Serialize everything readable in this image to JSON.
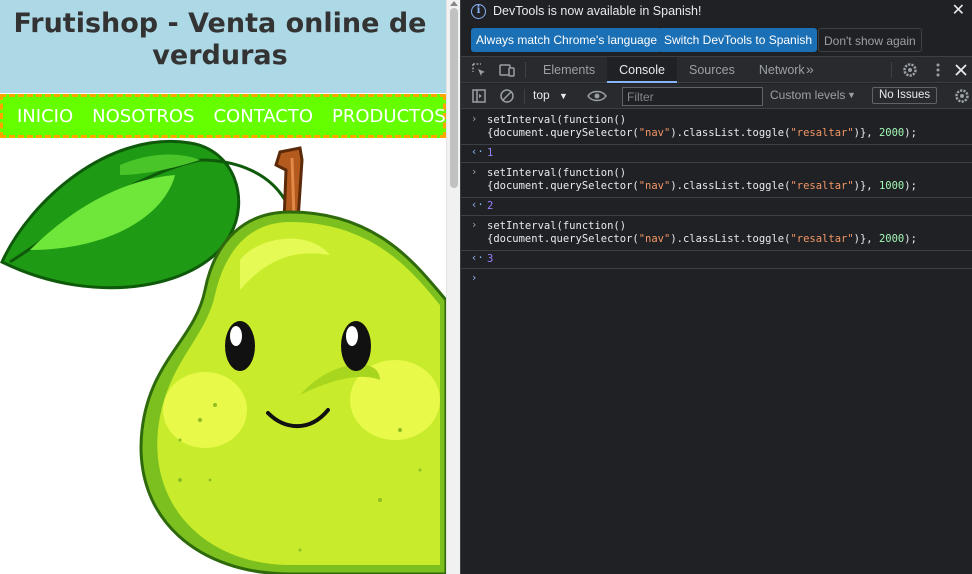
{
  "page": {
    "title": "Frutishop - Venta online de verduras",
    "nav": [
      "INICIO",
      "NOSOTROS",
      "CONTACTO",
      "PRODUCTOS"
    ]
  },
  "devtools": {
    "infobar": {
      "message": "DevTools is now available in Spanish!",
      "btn_match": "Always match Chrome's language",
      "btn_switch": "Switch DevTools to Spanish",
      "btn_dontshow": "Don't show again"
    },
    "tabs": [
      "Elements",
      "Console",
      "Sources",
      "Network"
    ],
    "active_tab": "Console",
    "toolbar": {
      "context": "top",
      "filter_placeholder": "Filter",
      "levels": "Custom levels",
      "issues": "No Issues"
    },
    "console": [
      {
        "line1": "setInterval(function()",
        "line2_a": "{document.querySelector(",
        "line2_str1": "\"nav\"",
        "line2_b": ").classList.toggle(",
        "line2_str2": "\"resaltar\"",
        "line2_c": ")}, ",
        "line2_num": "2000",
        "line2_d": ");",
        "result": "1"
      },
      {
        "line1": "setInterval(function()",
        "line2_a": "{document.querySelector(",
        "line2_str1": "\"nav\"",
        "line2_b": ").classList.toggle(",
        "line2_str2": "\"resaltar\"",
        "line2_c": ")}, ",
        "line2_num": "1000",
        "line2_d": ");",
        "result": "2"
      },
      {
        "line1": "setInterval(function()",
        "line2_a": "{document.querySelector(",
        "line2_str1": "\"nav\"",
        "line2_b": ").classList.toggle(",
        "line2_str2": "\"resaltar\"",
        "line2_c": ")}, ",
        "line2_num": "2000",
        "line2_d": ");",
        "result": "3"
      }
    ],
    "colors": {
      "accent": "#8ab4f8",
      "button": "#1a6fb5",
      "nav_bg": "#66ff00",
      "nav_border": "#ffa500",
      "header_bg": "#add8e6"
    }
  }
}
